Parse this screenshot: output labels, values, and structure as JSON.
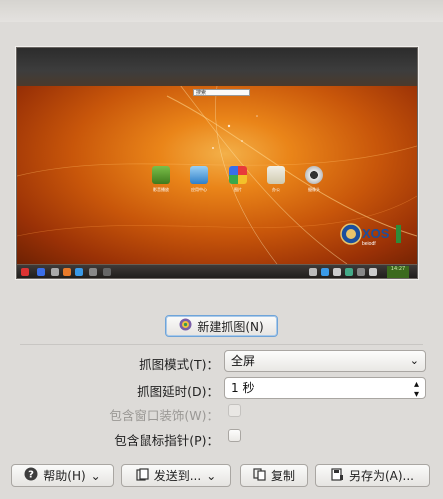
{
  "preview": {
    "desktop_search_text": "搜索",
    "icons": [
      {
        "name": "media-player-icon",
        "label": "影音播放"
      },
      {
        "name": "app-store-icon",
        "label": "应用中心"
      },
      {
        "name": "photo-gallery-icon",
        "label": "图片"
      },
      {
        "name": "office-icon",
        "label": "办公"
      },
      {
        "name": "webcam-icon",
        "label": "摄像头"
      }
    ],
    "logo_text": "XOS",
    "logo_sub": "beiodf",
    "clock_time": "14:27"
  },
  "actions": {
    "new_capture_label": "新建抓图(N)"
  },
  "options": {
    "mode_label": "抓图模式(T)：",
    "mode_value": "全屏",
    "delay_label": "抓图延时(D)：",
    "delay_value": "1 秒",
    "window_decorations_label": "包含窗口装饰(W)：",
    "mouse_pointer_label": "包含鼠标指针(P)："
  },
  "footer": {
    "help_label": "帮助(H)",
    "send_to_label": "发送到...",
    "copy_label": "复制",
    "save_as_label": "另存为(A)..."
  },
  "colors": {
    "accent_focus": "#6fa4d8",
    "desktop_orange": "#ea8519"
  }
}
